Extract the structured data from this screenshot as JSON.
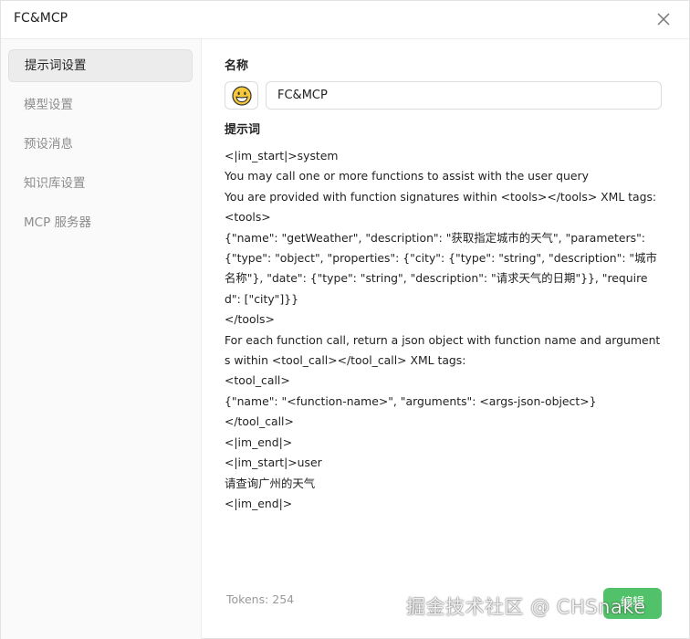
{
  "window": {
    "title": "FC&MCP"
  },
  "sidebar": {
    "items": [
      {
        "label": "提示词设置",
        "active": true
      },
      {
        "label": "模型设置",
        "active": false
      },
      {
        "label": "预设消息",
        "active": false
      },
      {
        "label": "知识库设置",
        "active": false
      },
      {
        "label": "MCP 服务器",
        "active": false
      }
    ]
  },
  "form": {
    "name_label": "名称",
    "emoji_icon": "grinning-face-icon",
    "name_value": "FC&MCP",
    "prompt_label": "提示词",
    "prompt_text": "<|im_start|>system\nYou may call one or more functions to assist with the user query\nYou are provided with function signatures within <tools></tools> XML tags:\n<tools>\n{\"name\": \"getWeather\", \"description\": \"获取指定城市的天气\", \"parameters\": {\"type\": \"object\", \"properties\": {\"city\": {\"type\": \"string\", \"description\": \"城市名称\"}, \"date\": {\"type\": \"string\", \"description\": \"请求天气的日期\"}}, \"required\": [\"city\"]}}\n</tools>\nFor each function call, return a json object with function name and arguments within <tool_call></tool_call> XML tags:\n<tool_call>\n{\"name\": \"<function-name>\", \"arguments\": <args-json-object>}\n</tool_call>\n<|im_end|>\n<|im_start|>user\n请查询广州的天气\n<|im_end|>"
  },
  "footer": {
    "tokens": "Tokens: 254",
    "edit_label": "编辑"
  },
  "watermark": "掘金技术社区 @ CHSnake",
  "colors": {
    "accent": "#52c26a",
    "sidebar_bg": "#fafafa",
    "active_item_bg": "#ececec"
  }
}
